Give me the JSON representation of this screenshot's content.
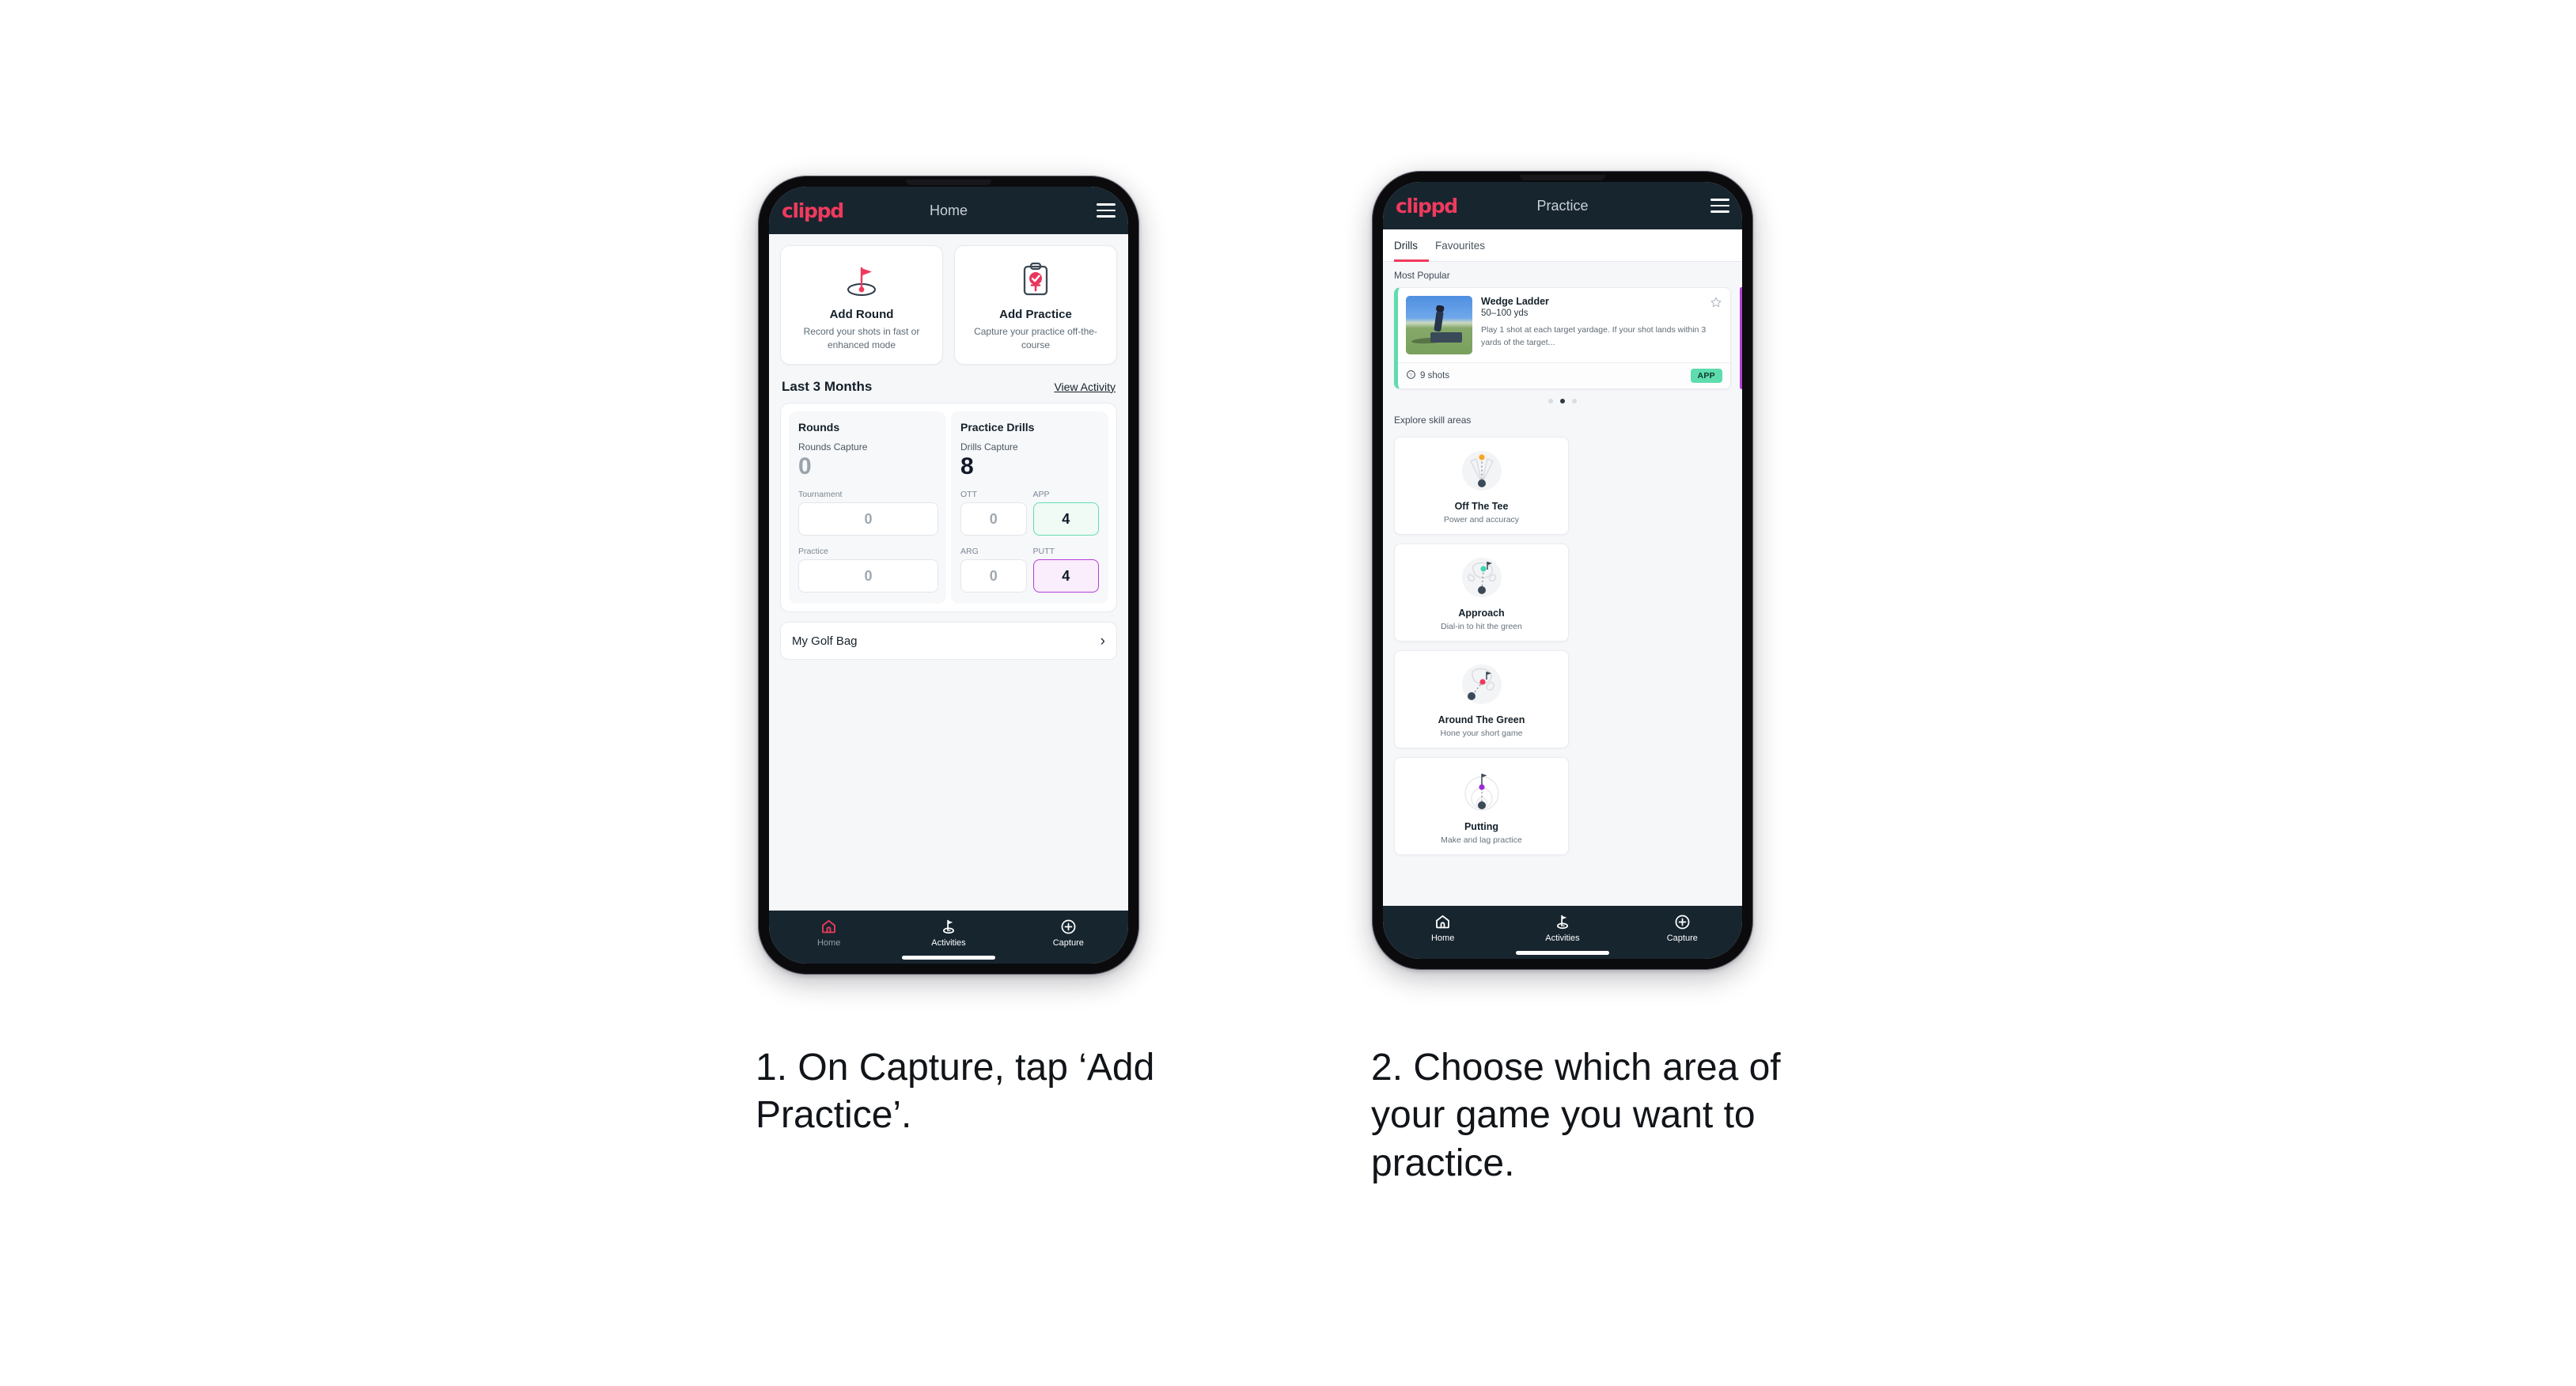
{
  "phones": {
    "left": {
      "appbar": {
        "logo": "clippd",
        "title": "Home",
        "menu_icon": "hamburger-icon"
      },
      "actions": [
        {
          "icon": "golf-flag-hole-icon",
          "title": "Add Round",
          "subtitle": "Record your shots in fast or enhanced mode"
        },
        {
          "icon": "clipboard-check-tee-icon",
          "title": "Add Practice",
          "subtitle": "Capture your practice off-the-course"
        }
      ],
      "section": {
        "title": "Last 3 Months",
        "link": "View Activity"
      },
      "stats": {
        "rounds": {
          "heading": "Rounds",
          "capture_label": "Rounds Capture",
          "capture_value": "0",
          "items": [
            {
              "label": "Tournament",
              "value": "0",
              "state": "empty"
            },
            {
              "label": "Practice",
              "value": "0",
              "state": "empty"
            }
          ]
        },
        "drills": {
          "heading": "Practice Drills",
          "capture_label": "Drills Capture",
          "capture_value": "8",
          "items": [
            {
              "label": "OTT",
              "value": "0",
              "state": "empty"
            },
            {
              "label": "APP",
              "value": "4",
              "state": "app"
            },
            {
              "label": "ARG",
              "value": "0",
              "state": "empty"
            },
            {
              "label": "PUTT",
              "value": "4",
              "state": "putt"
            }
          ]
        }
      },
      "bag": {
        "label": "My Golf Bag",
        "chevron_icon": "chevron-right-icon"
      },
      "tabbar": [
        {
          "label": "Home",
          "icon": "home-icon",
          "active": true
        },
        {
          "label": "Activities",
          "icon": "golf-flag-icon",
          "active": false
        },
        {
          "label": "Capture",
          "icon": "plus-circle-icon",
          "active": false
        }
      ]
    },
    "right": {
      "appbar": {
        "logo": "clippd",
        "title": "Practice",
        "menu_icon": "hamburger-icon"
      },
      "tabs": [
        {
          "label": "Drills",
          "active": true
        },
        {
          "label": "Favourites",
          "active": false
        }
      ],
      "most_popular_label": "Most Popular",
      "drill": {
        "name": "Wedge Ladder",
        "yardage": "50–100 yds",
        "description": "Play 1 shot at each target yardage. If your shot lands within 3 yards of the target...",
        "shots": "9 shots",
        "shots_icon": "golf-ball-icon",
        "badge": "APP",
        "star_icon": "star-outline-icon",
        "thumbnail": "golfer-hitting-wedge-photo",
        "accent_color": "#5fdcae",
        "next_accent_color": "#b33fd6"
      },
      "carousel_dots": {
        "count": 3,
        "active_index": 1
      },
      "explore_label": "Explore skill areas",
      "skills": [
        {
          "icon": "tee-shot-dispersion-icon",
          "title": "Off The Tee",
          "subtitle": "Power and accuracy",
          "dot_color": "#f5a623"
        },
        {
          "icon": "green-approach-icon",
          "title": "Approach",
          "subtitle": "Dial-in to hit the green",
          "dot_color": "#3fd6b0"
        },
        {
          "icon": "chip-around-green-icon",
          "title": "Around The Green",
          "subtitle": "Hone your short game",
          "dot_color": "#ef3a5d"
        },
        {
          "icon": "putting-rings-icon",
          "title": "Putting",
          "subtitle": "Make and lag practice",
          "dot_color": "#9a2fd0"
        }
      ],
      "tabbar": [
        {
          "label": "Home",
          "icon": "home-icon",
          "active": false
        },
        {
          "label": "Activities",
          "icon": "golf-flag-icon",
          "active": false
        },
        {
          "label": "Capture",
          "icon": "plus-circle-icon",
          "active": false
        }
      ]
    }
  },
  "captions": {
    "step1": "1. On Capture, tap ‘Add Practice’.",
    "step2": "2. Choose which area of your game you want to practice."
  },
  "colors": {
    "brand": "#ef3a5d",
    "navy": "#17252f",
    "green": "#5fdcae",
    "purple": "#b33fd6"
  }
}
